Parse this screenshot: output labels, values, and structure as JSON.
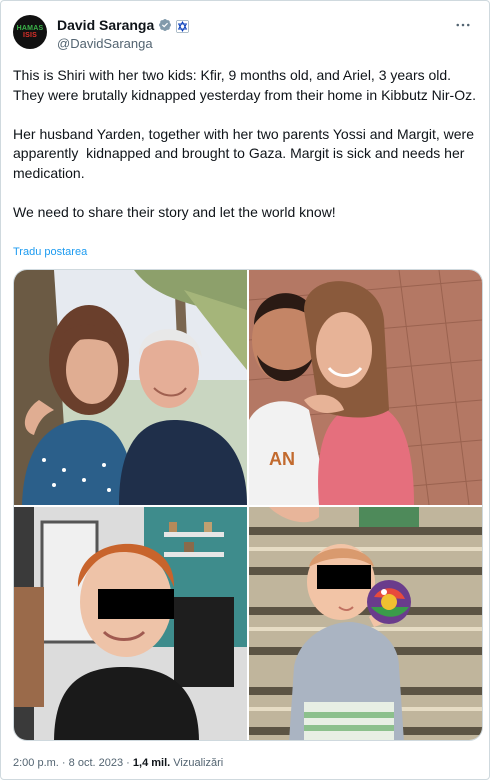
{
  "tweet": {
    "author": {
      "display_name": "David Saranga",
      "handle": "@DavidSaranga",
      "avatar_text_1": "HAMAS",
      "avatar_text_2": "ISIS",
      "avatar_icon": "hamas-is-isis-logo"
    },
    "more_icon": "more-horizontal-icon",
    "paragraphs": [
      "This is Shiri with her two kids: Kfir, 9 months old, and Ariel, 3 years old. They were brutally kidnapped yesterday from their home in Kibbutz Nir-Oz.",
      "Her husband Yarden, together with her two parents Yossi and Margit, were apparently  kidnapped and brought to Gaza. Margit is sick and needs her medication.",
      "We need to share their story and let the world know!"
    ],
    "translate_label": "Tradu postarea",
    "media": [
      {
        "name": "photo-elderly-couple"
      },
      {
        "name": "photo-young-couple"
      },
      {
        "name": "photo-redhaired-boy"
      },
      {
        "name": "photo-baby"
      }
    ],
    "time": "2:00 p.m.",
    "separator": "·",
    "date": "8 oct. 2023",
    "views_count": "1,4 mil.",
    "views_label": "Vizualizări",
    "colors": {
      "accent": "#1d9bf0",
      "secondary_text": "#536471",
      "border": "#cfd9de"
    }
  }
}
